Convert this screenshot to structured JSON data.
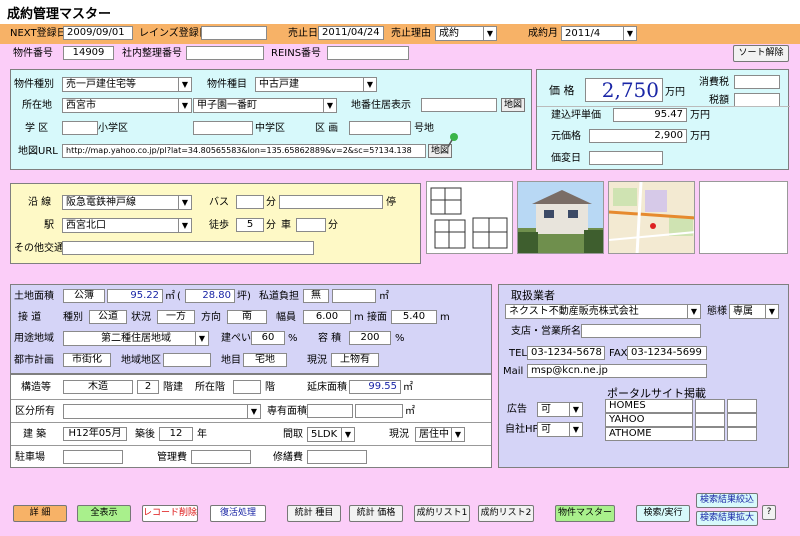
{
  "window": {
    "title": "成約管理マスター"
  },
  "top": {
    "next_label": "NEXT登録日",
    "next_date": "2009/09/01",
    "reins_label": "レインズ登録日",
    "sold_label": "売止日",
    "sold_date": "2011/04/24",
    "reason_label": "売止理由",
    "reason": "成約",
    "month_label": "成約月",
    "month": "2011/4"
  },
  "row2": {
    "no_label": "物件番号",
    "no": "14909",
    "inner_label": "社内整理番号",
    "reins_no_label": "REINS番号",
    "sort_btn": "ソート解除"
  },
  "prop": {
    "type_label": "物件種別",
    "type": "売一戸建住宅等",
    "kind_label": "物件種目",
    "kind": "中古戸建",
    "loc_label": "所在地",
    "city": "西宮市",
    "town": "甲子園一番町",
    "lotdisp_label": "地番住居表示",
    "map_btn": "地図",
    "school_label": "学 区",
    "elem_label": "小学区",
    "mid_label": "中学区",
    "ward_label": "区 画",
    "lotno_label": "号地",
    "url_label": "地図URL",
    "url": "http://map.yahoo.co.jp/pl?lat=34.80565583&lon=135.65862889&v=2&sc=5?134.138",
    "map_btn2": "地図"
  },
  "price": {
    "price_label": "価 格",
    "price": "2,750",
    "man": "万円",
    "tax_label": "消費税",
    "tax2_label": "税額",
    "tsubo_label": "建込坪単価",
    "tsubo": "95.47",
    "orig_label": "元価格",
    "orig": "2,900",
    "change_label": "価変日"
  },
  "transit": {
    "line_label": "沿 線",
    "line": "阪急電鉄神戸線",
    "bus_label": "バス",
    "fun": "分",
    "stop_label": "停",
    "station_label": "駅",
    "station": "西宮北口",
    "walk_label": "徒歩",
    "walk": "5",
    "car_label": "車",
    "other_label": "その他交通"
  },
  "land": {
    "area_label": "土地面積",
    "area_type": "公簿",
    "area": "95.22",
    "m2": "㎡",
    "tsubo": "28.80",
    "tsubo_unit": "坪)",
    "road_label": "私道負担",
    "road": "無",
    "m2b": "㎡",
    "access_label": "接 道",
    "kind_label": "種別",
    "kind": "公道",
    "state_label": "状況",
    "state": "一方",
    "dir_label": "方向",
    "dir": "南",
    "width_label": "幅員",
    "width": "6.00",
    "m": "m",
    "face_label": "接面",
    "face": "5.40",
    "m2x": "m",
    "use_label": "用途地域",
    "use": "第二種住居地域",
    "cov_label": "建ぺい",
    "cov": "60",
    "pct": "%",
    "far_label": "容 積",
    "far": "200",
    "pct2": "%",
    "plan_label": "都市計画",
    "plan": "市街化",
    "district_label": "地域地区",
    "landcat_label": "地目",
    "landcat": "宅地",
    "cur_label": "現況",
    "cur": "上物有"
  },
  "bldg": {
    "struct_label": "構造等",
    "struct": "木造",
    "floors": "2",
    "floor_unit": "階建",
    "loc_floor_label": "所在階",
    "loc_floor_unit": "階",
    "floor_area_label": "延床面積",
    "floor_area": "99.55",
    "m2": "㎡",
    "section_label": "区分所有",
    "private_label": "専有面積",
    "m2b": "㎡",
    "built_label": "建 築",
    "built": "H12年05月",
    "age_label": "築後",
    "age": "12",
    "year": "年",
    "layout_label": "間取",
    "layout": "5LDK",
    "status_label": "現況",
    "status": "居住中",
    "parking_label": "駐車場",
    "mgmt_label": "管理費",
    "repair_label": "修繕費"
  },
  "agent": {
    "title": "取扱業者",
    "name": "ネクスト不動産販売株式会社",
    "mode_label": "態様",
    "mode": "専属",
    "branch_label": "支店・営業所名",
    "tel_label": "TEL",
    "tel": "03-1234-5678",
    "fax_label": "FAX",
    "fax": "03-1234-5699",
    "mail_label": "Mail",
    "mail": "msp@kcn.ne.jp",
    "portal_title": "ポータルサイト掲載",
    "ad_label": "広告",
    "ad": "可",
    "hp_label": "自社HP",
    "hp": "可",
    "portals": [
      "HOMES",
      "YAHOO",
      "ATHOME"
    ]
  },
  "buttons": {
    "detail": "詳 細",
    "all": "全表示",
    "del": "レコード削除",
    "restore": "復活処理",
    "stat1": "統計 種目",
    "stat2": "統計 価格",
    "list1": "成約リスト1",
    "list2": "成約リスト2",
    "master": "物件マスター",
    "search": "検索/実行",
    "narrow": "検索結果絞込",
    "expand": "検索結果拡大",
    "help": "?"
  },
  "colors": {
    "bg": "#fbcdf8",
    "band": "#f7b267",
    "cyan": "#d7f9fb",
    "yellow": "#fef9c6",
    "lavender": "#d5d4f7",
    "price": "#1a26a6"
  }
}
